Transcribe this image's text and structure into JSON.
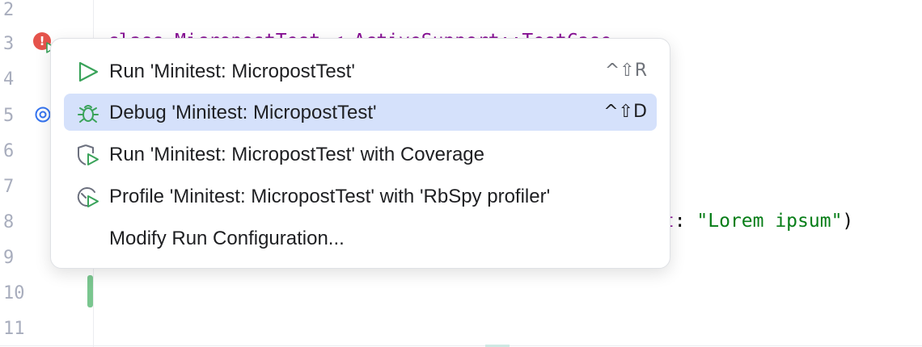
{
  "editor": {
    "line_numbers": [
      "2",
      "3",
      "4",
      "5",
      "6",
      "7",
      "8",
      "9",
      "10",
      "11"
    ],
    "line8_code": {
      "key": "nt",
      "sep": ": ",
      "string": "\"Lorem ipsum\"",
      "tail": ")"
    },
    "hidden_line3_fragment": "class MicropostTest < ActiveSupport::TestCase"
  },
  "gutter": {
    "error_mark": "!"
  },
  "context_menu": {
    "items": [
      {
        "label": "Run 'Minitest: MicropostTest'",
        "shortcut": "^⇧R",
        "icon": "run-icon"
      },
      {
        "label": "Debug 'Minitest: MicropostTest'",
        "shortcut": "^⇧D",
        "icon": "debug-icon",
        "selected": true
      },
      {
        "label": "Run 'Minitest: MicropostTest' with Coverage",
        "shortcut": "",
        "icon": "coverage-icon"
      },
      {
        "label": "Profile 'Minitest: MicropostTest' with 'RbSpy profiler'",
        "shortcut": "",
        "icon": "profiler-icon"
      },
      {
        "label": "Modify Run Configuration...",
        "shortcut": "",
        "icon": ""
      }
    ]
  },
  "colors": {
    "selection": "#d5e1fb",
    "run_green": "#3aa35a",
    "error_red": "#e5534b",
    "keyword_purple": "#871094",
    "string_green": "#067d17"
  }
}
